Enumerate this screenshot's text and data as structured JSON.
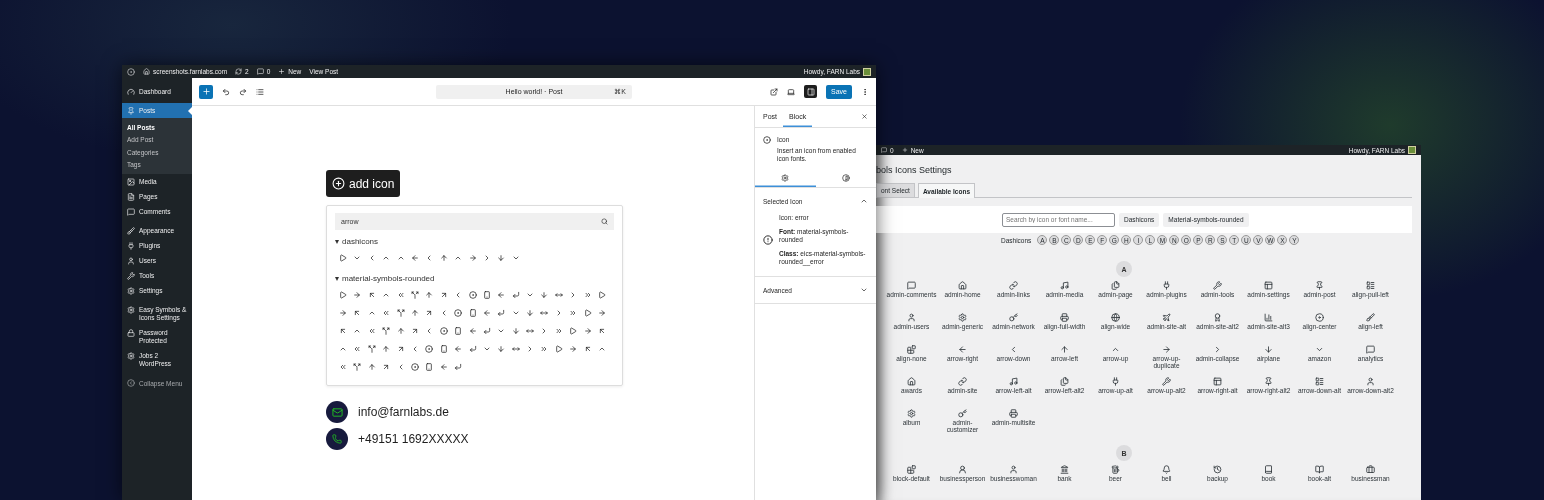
{
  "front_window": {
    "admin_bar": {
      "site": "screenshots.farnlabs.com",
      "updates": "2",
      "comments": "0",
      "new": "New",
      "view_post": "View Post",
      "greeting": "Howdy, FARN Labs"
    },
    "sidebar": {
      "sections": [
        [
          {
            "label": "Dashboard",
            "selected": false
          }
        ],
        [
          {
            "label": "Posts",
            "selected": true,
            "children": [
              {
                "label": "All Posts",
                "selected": true
              },
              {
                "label": "Add Post",
                "selected": false
              },
              {
                "label": "Categories",
                "selected": false
              },
              {
                "label": "Tags",
                "selected": false
              }
            ]
          },
          {
            "label": "Media",
            "selected": false
          },
          {
            "label": "Pages",
            "selected": false
          },
          {
            "label": "Comments",
            "selected": false
          }
        ],
        [
          {
            "label": "Appearance",
            "selected": false
          },
          {
            "label": "Plugins",
            "selected": false
          },
          {
            "label": "Users",
            "selected": false
          },
          {
            "label": "Tools",
            "selected": false
          },
          {
            "label": "Settings",
            "selected": false
          }
        ],
        [
          {
            "label": "Easy Symbols & Icons Settings",
            "selected": false
          },
          {
            "label": "Password Protected",
            "selected": false
          },
          {
            "label": "Jobs 2 WordPress",
            "selected": false
          }
        ]
      ],
      "collapse": "Collapse Menu"
    },
    "editor_header": {
      "document_title": "Hello world! · Post",
      "shortcut": "⌘K",
      "sidebar_toggle_on": true,
      "save": "Save"
    },
    "canvas": {
      "add_icon": "add icon",
      "search": {
        "value": "arrow"
      },
      "groups": [
        {
          "name": "dashicons",
          "expanded": true
        },
        {
          "name": "material-symbols-rounded",
          "expanded": true
        }
      ],
      "contacts": [
        {
          "kind": "email",
          "text": "info@farnlabs.de"
        },
        {
          "kind": "phone",
          "text": "+49151 1692XXXXX"
        }
      ]
    },
    "inspector": {
      "tabs": [
        {
          "label": "Post",
          "selected": false
        },
        {
          "label": "Block",
          "selected": true
        }
      ],
      "block": {
        "title": "Icon",
        "description": "Insert an icon from enabled icon fonts."
      },
      "subtabs": [
        {
          "kind": "settings",
          "selected": true
        },
        {
          "kind": "styles",
          "selected": false
        }
      ],
      "panels": [
        {
          "title": "Selected Icon",
          "expanded": true,
          "lines": [
            "Icon: error",
            "**Font:** material-symbols-rounded",
            "**Class:** eics-material-symbols-rounded__error"
          ]
        },
        {
          "title": "Advanced",
          "expanded": false
        }
      ]
    }
  },
  "back_window": {
    "admin_bar": {
      "comments": "0",
      "new": "New",
      "greeting": "Howdy, FARN Labs"
    },
    "title": "bols Icons Settings",
    "tabs": [
      {
        "label": "ont Select",
        "selected": false
      },
      {
        "label": "Available Icons",
        "selected": true
      }
    ],
    "search": {
      "placeholder": "Search by icon or font name..."
    },
    "font_buttons": [
      "Dashicons",
      "Material-symbols-rounded"
    ],
    "letter_index": {
      "label": "Dashicons",
      "letters": [
        "A",
        "B",
        "C",
        "D",
        "E",
        "F",
        "G",
        "H",
        "I",
        "L",
        "M",
        "N",
        "O",
        "P",
        "R",
        "S",
        "T",
        "U",
        "V",
        "W",
        "X",
        "Y"
      ]
    },
    "sections": [
      {
        "letter": "A",
        "icons": [
          "admin-comments",
          "admin-home",
          "admin-links",
          "admin-media",
          "admin-page",
          "admin-plugins",
          "admin-tools",
          "admin-settings",
          "admin-post",
          "align-pull-left",
          "admin-users",
          "admin-generic",
          "admin-network",
          "align-full-width",
          "align-wide",
          "admin-site-alt",
          "admin-site-alt2",
          "admin-site-alt3",
          "align-center",
          "align-left",
          "align-none",
          "arrow-right",
          "arrow-down",
          "arrow-left",
          "arrow-up",
          "arrow-up-duplicate",
          "admin-collapse",
          "airplane",
          "amazon",
          "analytics",
          "awards",
          "admin-site",
          "arrow-left-alt",
          "arrow-left-alt2",
          "arrow-up-alt",
          "arrow-up-alt2",
          "arrow-right-alt",
          "arrow-right-alt2",
          "arrow-down-alt",
          "arrow-down-alt2",
          "album",
          "admin-customizer",
          "admin-multisite"
        ]
      },
      {
        "letter": "B",
        "icons": [
          "block-default",
          "businessperson",
          "businesswoman",
          "bank",
          "beer",
          "bell",
          "backup",
          "book",
          "book-alt",
          "businessman"
        ]
      }
    ]
  }
}
